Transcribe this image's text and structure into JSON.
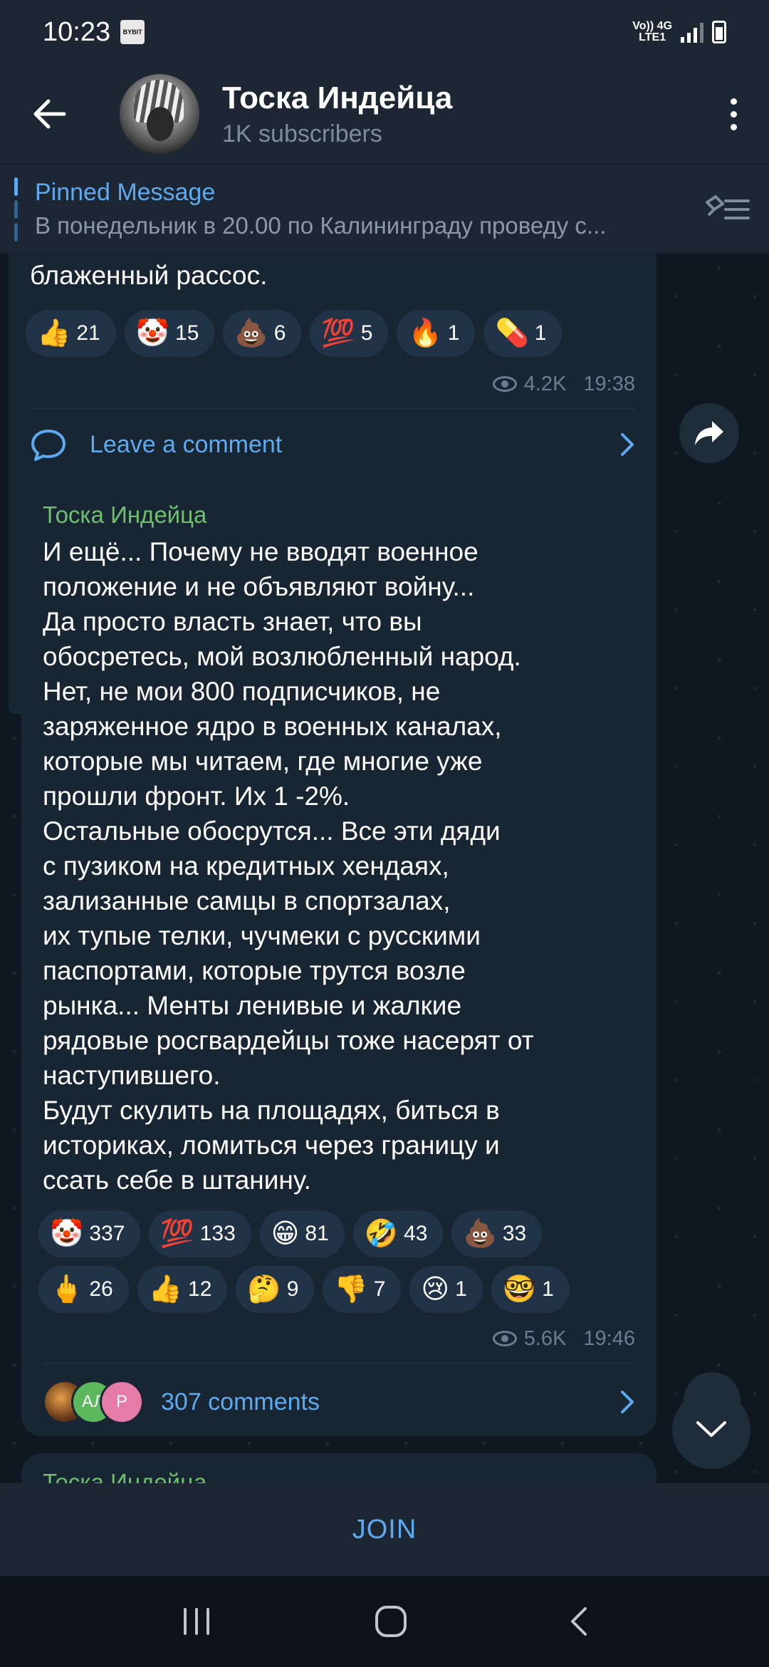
{
  "status_bar": {
    "time": "10:23",
    "app_badge": "BYBIT",
    "net_top": "Vo)) 4G",
    "net_bottom": "LTE1"
  },
  "header": {
    "title": "Тоска Индейца",
    "subtitle": "1K subscribers"
  },
  "pinned": {
    "title": "Pinned Message",
    "text": "В понедельник в 20.00 по Калининграду проведу с..."
  },
  "messages": [
    {
      "text_tail": "блаженный рассос.",
      "reactions": [
        {
          "emoji": "👍",
          "count": "21"
        },
        {
          "emoji": "🤡",
          "count": "15"
        },
        {
          "emoji": "💩",
          "count": "6"
        },
        {
          "emoji": "💯",
          "count": "5"
        },
        {
          "emoji": "🔥",
          "count": "1"
        },
        {
          "emoji": "💊",
          "count": "1"
        }
      ],
      "views": "4.2K",
      "time": "19:38",
      "comment_label": "Leave a comment"
    },
    {
      "sender": "Тоска Индейца",
      "text": "И ещё... Почему не вводят военное\nположение и не объявляют войну...\nДа просто власть знает, что вы\nобосретесь, мой возлюбленный народ.\nНет, не мои 800 подписчиков, не\nзаряженное ядро в военных каналах,\nкоторые мы читаем, где многие уже\nпрошли фронт. Их 1 -2%.\nОстальные обосрутся... Все эти дяди\nс пузиком на кредитных хендаях,\nзализанные самцы в спортзалах,\nих тупые телки, чучмеки с русскими\nпаспортами, которые трутся возле\nрынка... Менты ленивые и жалкие\nрядовые росгвардейцы тоже насерят от\nнаступившего.\nБудут скулить на площадях, биться в\nисториках, ломиться через границу и\nссать себе в штанину.",
      "reactions": [
        {
          "emoji": "🤡",
          "count": "337"
        },
        {
          "emoji": "💯",
          "count": "133"
        },
        {
          "emoji": "😁",
          "count": "81"
        },
        {
          "emoji": "🤣",
          "count": "43"
        },
        {
          "emoji": "💩",
          "count": "33"
        },
        {
          "emoji": "🖕",
          "count": "26"
        },
        {
          "emoji": "👍",
          "count": "12"
        },
        {
          "emoji": "🤔",
          "count": "9"
        },
        {
          "emoji": "👎",
          "count": "7"
        },
        {
          "emoji": "😢",
          "count": "1"
        },
        {
          "emoji": "🤓",
          "count": "1"
        }
      ],
      "views": "5.6K",
      "time": "19:46",
      "commenter_initials": [
        "",
        "АЛ",
        "Р"
      ],
      "comment_label": "307 comments"
    },
    {
      "sender": "Тоска Индейца"
    }
  ],
  "join_label": "JOIN",
  "colors": {
    "accent": "#5eaaf0",
    "sender": "#6fbf6f",
    "bubble": "#182533",
    "background": "#0e1621"
  }
}
